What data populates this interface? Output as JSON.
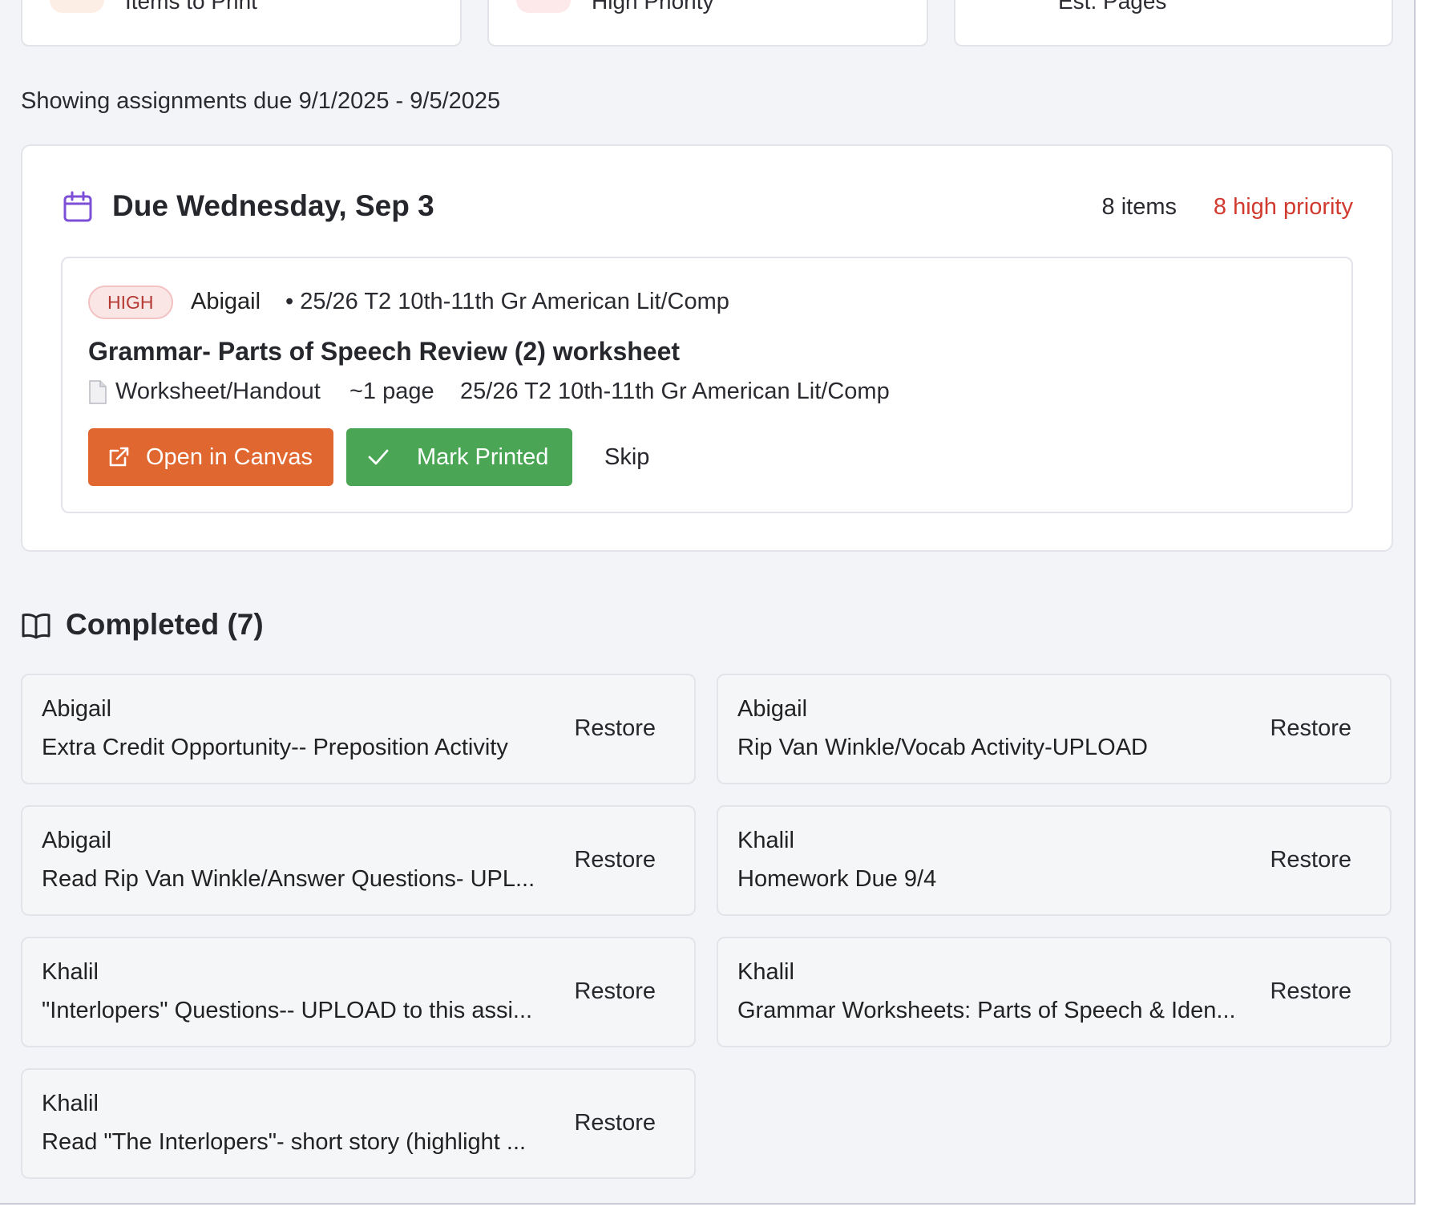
{
  "stats": [
    {
      "label": "Items to Print",
      "accent": "#fdeee5"
    },
    {
      "label": "High Priority",
      "accent": "#fde8ea"
    },
    {
      "label": "Est. Pages",
      "accent": "#ffffff"
    }
  ],
  "range_text": "Showing assignments due 9/1/2025 - 9/5/2025",
  "due_group": {
    "icon": "calendar-icon",
    "title": "Due Wednesday, Sep 3",
    "count": "8 items",
    "high_count": "8 high priority",
    "assignment": {
      "priority": "HIGH",
      "student": "Abigail",
      "course": "• 25/26 T2 10th-11th Gr American Lit/Comp",
      "title": "Grammar- Parts of Speech Review (2) worksheet",
      "type": "Worksheet/Handout",
      "pages": "~1 page",
      "course_meta": "25/26 T2 10th-11th Gr American Lit/Comp",
      "actions": {
        "open": "Open in Canvas",
        "mark": "Mark Printed",
        "skip": "Skip"
      }
    }
  },
  "completed": {
    "icon": "book-open-icon",
    "title": "Completed (7)",
    "restore_label": "Restore",
    "items": [
      {
        "student": "Abigail",
        "title": "Extra Credit Opportunity-- Preposition Activity"
      },
      {
        "student": "Abigail",
        "title": "Rip Van Winkle/Vocab Activity-UPLOAD"
      },
      {
        "student": "Abigail",
        "title": "Read Rip Van Winkle/Answer Questions- UPL..."
      },
      {
        "student": "Khalil",
        "title": "Homework Due 9/4"
      },
      {
        "student": "Khalil",
        "title": "\"Interlopers\" Questions-- UPLOAD to this assi..."
      },
      {
        "student": "Khalil",
        "title": "Grammar Worksheets: Parts of Speech & Iden..."
      },
      {
        "student": "Khalil",
        "title": "Read \"The Interlopers\"- short story (highlight ..."
      }
    ]
  },
  "colors": {
    "accent_orange": "#e0672f",
    "accent_green": "#4aa654",
    "high_red": "#d13a2e",
    "calendar_purple": "#7c4fd6"
  }
}
